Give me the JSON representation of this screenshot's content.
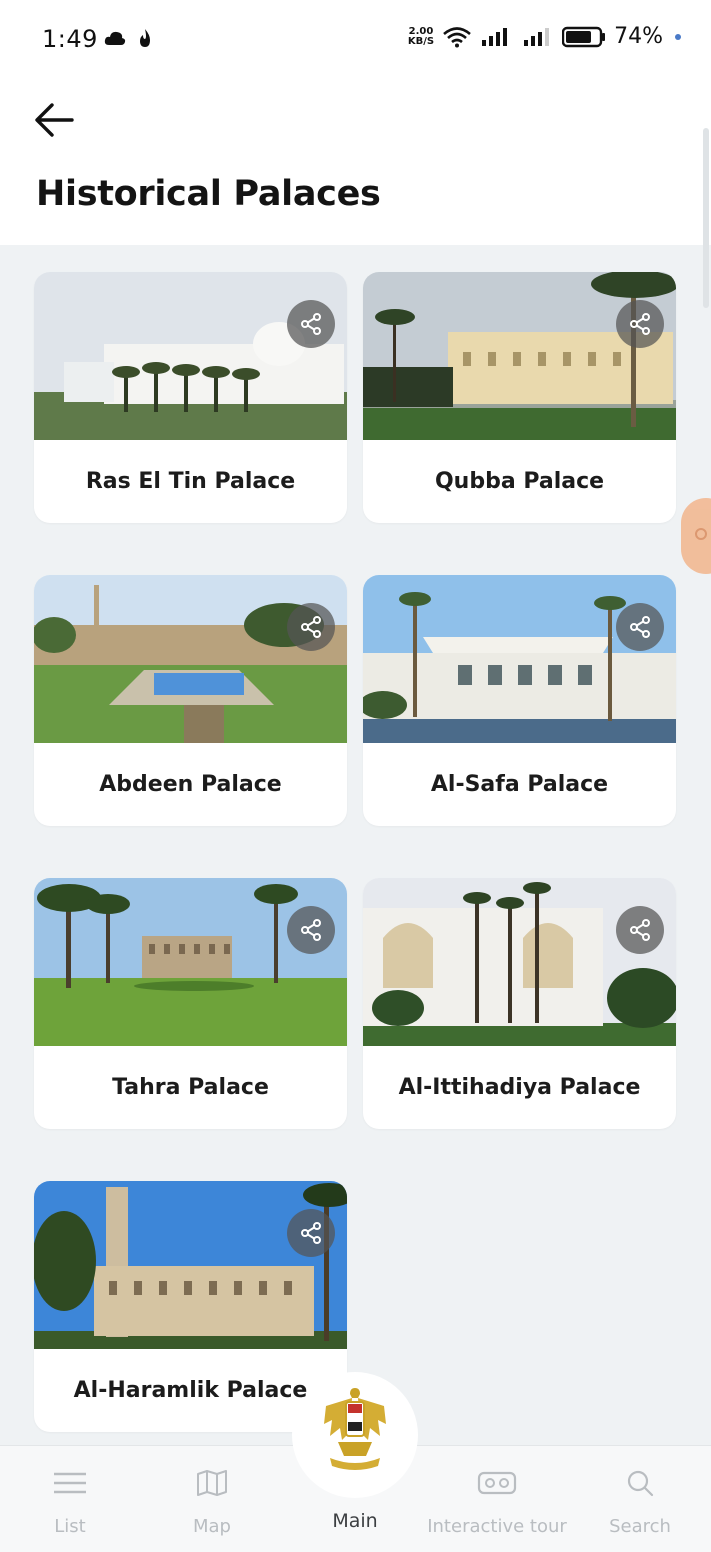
{
  "status_bar": {
    "time": "1:49",
    "net_speed_value": "2.00",
    "net_speed_unit": "KB/S",
    "battery": "74%"
  },
  "header": {
    "back_icon": "arrow-left-icon",
    "title": "Historical Palaces"
  },
  "palaces": [
    {
      "name": "Ras El Tin Palace"
    },
    {
      "name": "Qubba Palace"
    },
    {
      "name": "Abdeen Palace"
    },
    {
      "name": "Al-Safa Palace"
    },
    {
      "name": "Tahra Palace"
    },
    {
      "name": "Al-Ittihadiya Palace"
    },
    {
      "name": "Al-Haramlik Palace"
    }
  ],
  "share_icon": "share-icon",
  "bottom_nav": {
    "list": "List",
    "map": "Map",
    "main": "Main",
    "tour": "Interactive tour",
    "search": "Search"
  },
  "colors": {
    "background": "#eff2f4",
    "card": "#ffffff",
    "nav_inactive": "#b9bdc1",
    "emblem_gold": "#c9a227"
  }
}
